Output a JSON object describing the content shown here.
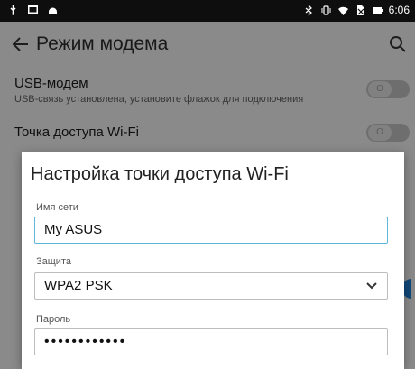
{
  "status_bar": {
    "time": "6:06",
    "left_icons": [
      "usb-icon",
      "image-icon",
      "android-icon"
    ],
    "right_icons": [
      "bluetooth-icon",
      "vibrate-icon",
      "wifi-icon",
      "no-sim-icon",
      "battery-icon"
    ]
  },
  "appbar": {
    "title": "Режим модема"
  },
  "settings": {
    "usb": {
      "title": "USB-модем",
      "subtitle": "USB-связь установлена, установите флажок для подключения",
      "toggle_text": "O"
    },
    "hotspot": {
      "title": "Точка доступа Wi-Fi",
      "toggle_text": "O"
    }
  },
  "dialog": {
    "title": "Настройка точки доступа Wi-Fi",
    "ssid_label": "Имя сети",
    "ssid_value": "My ASUS",
    "security_label": "Защита",
    "security_value": "WPA2 PSK",
    "password_label": "Пароль",
    "password_value": "••••••••••••"
  },
  "colors": {
    "accent": "#5fb6da",
    "side_button": "#1c78c9"
  }
}
